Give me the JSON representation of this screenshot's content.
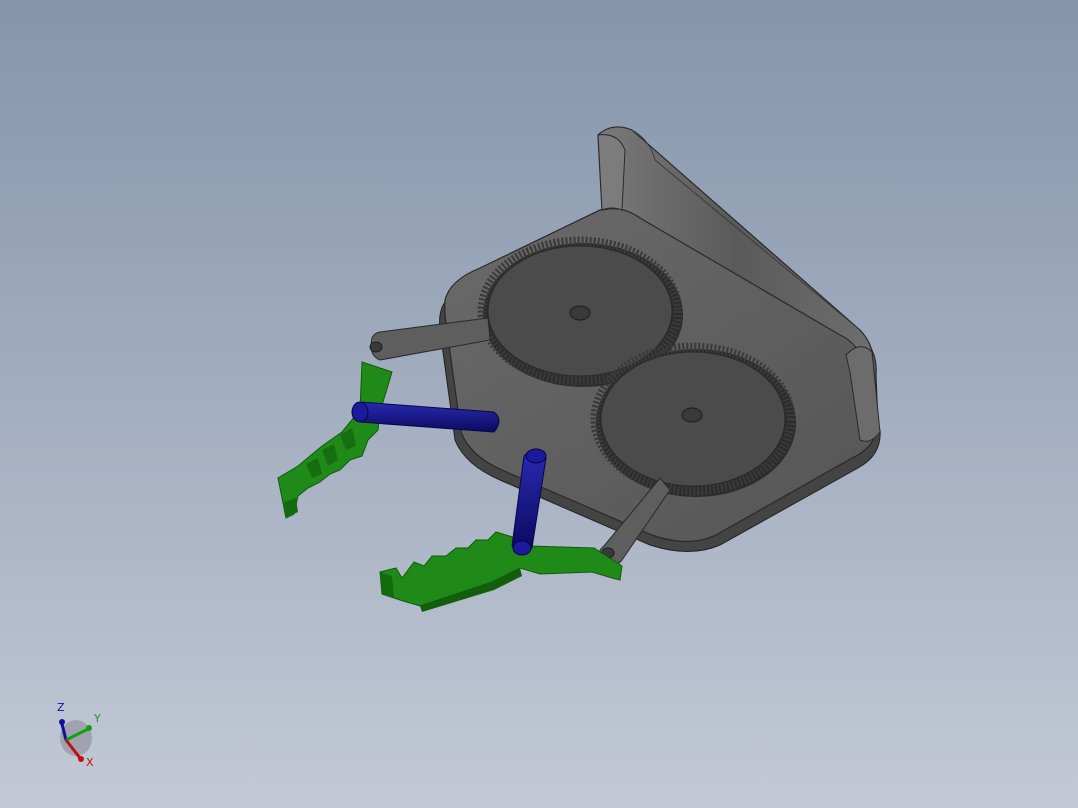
{
  "viewport": {
    "background_top": "#8595ab",
    "background_bottom": "#c3c9d6"
  },
  "colors": {
    "base_plate": "#5c5c5c",
    "base_plate_dark": "#3f3f3f",
    "gear": "#4a4a4a",
    "gear_dark": "#2e2e2e",
    "arm_link": "#5a5a5a",
    "coupler_link": "#10107a",
    "jaw": "#1f8a17",
    "jaw_dark": "#0f5c0a",
    "axis_x": "#c01010",
    "axis_y": "#10a010",
    "axis_z": "#1010a0"
  },
  "model": {
    "parts": [
      {
        "name": "base-plate",
        "icon": "base-plate-shape"
      },
      {
        "name": "gear-upper",
        "icon": "spur-gear-shape"
      },
      {
        "name": "gear-lower",
        "icon": "spur-gear-shape"
      },
      {
        "name": "arm-link-upper",
        "icon": "link-shape"
      },
      {
        "name": "arm-link-lower",
        "icon": "link-shape"
      },
      {
        "name": "coupler-link-upper",
        "icon": "link-shape"
      },
      {
        "name": "coupler-link-lower",
        "icon": "link-shape"
      },
      {
        "name": "jaw-upper",
        "icon": "serrated-jaw-shape"
      },
      {
        "name": "jaw-lower",
        "icon": "serrated-jaw-shape"
      }
    ]
  },
  "triad": {
    "x_label": "X",
    "y_label": "Y",
    "z_label": "Z"
  }
}
